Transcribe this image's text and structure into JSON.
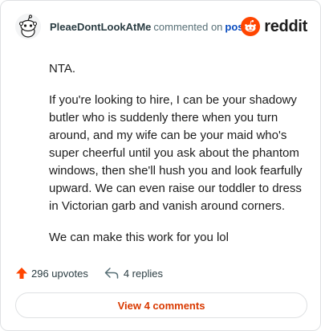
{
  "comment": {
    "username": "PleaeDontLookAtMe",
    "verb": "commented on",
    "post_link": "post",
    "brand": "reddit",
    "paragraphs": [
      "NTA.",
      "If you're looking to hire, I can be your shadowy butler who is suddenly there when you turn around, and my wife can be your maid who's super cheerful until you ask about the phantom windows, then she'll hush you and look fearfully upward. We can even raise our toddler to dress in Victorian garb and vanish around corners.",
      "We can make this work for you lol"
    ],
    "upvotes": "296 upvotes",
    "replies": "4 replies",
    "view_comments": "View 4 comments"
  },
  "colors": {
    "brand": "#ff4500",
    "upvote": "#ff4500",
    "link": "#0b4dbf",
    "view_button_text": "#d93900"
  },
  "icons": {
    "avatar": "snoo-avatar",
    "brand": "reddit-logo-icon",
    "upvote": "upvote-arrow-icon",
    "reply": "reply-arrow-icon"
  }
}
